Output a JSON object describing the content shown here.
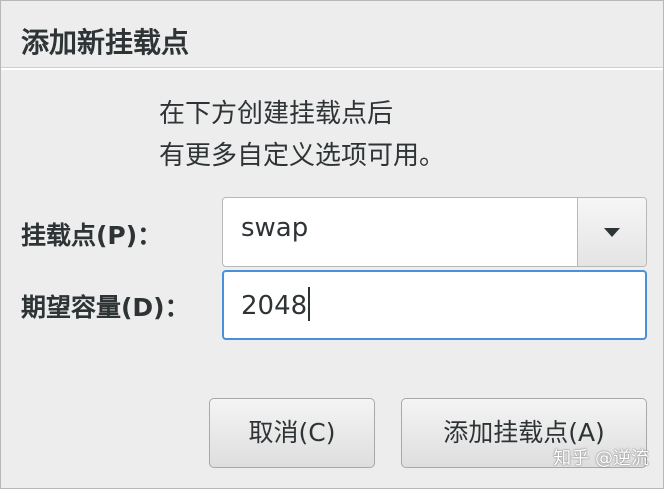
{
  "dialog": {
    "title": "添加新挂载点",
    "description_line1": "在下方创建挂载点后",
    "description_line2": "有更多自定义选项可用。"
  },
  "fields": {
    "mount_point_label": "挂载点(P)：",
    "mount_point_value": "swap",
    "capacity_label": "期望容量(D)：",
    "capacity_value": "2048"
  },
  "buttons": {
    "cancel": "取消(C)",
    "add_mount_point": "添加挂载点(A)"
  },
  "watermark": "知乎 @逆流",
  "colors": {
    "focus_border": "#4a90d9",
    "dialog_bg": "#ededed"
  },
  "icons": {
    "combo_arrow": "chevron-down-icon"
  }
}
